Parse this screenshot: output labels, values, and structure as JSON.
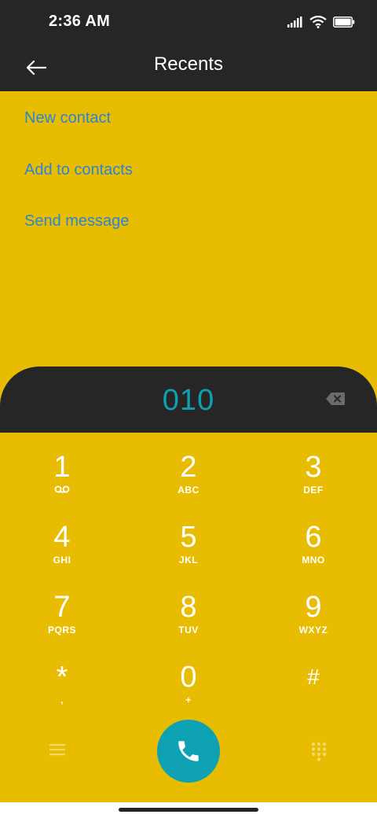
{
  "status": {
    "time": "2:36 AM"
  },
  "app_bar": {
    "title": "Recents"
  },
  "actions": [
    {
      "label": "New contact"
    },
    {
      "label": "Add to contacts"
    },
    {
      "label": "Send message"
    }
  ],
  "dialer": {
    "number": "010",
    "keys": [
      {
        "digit": "1",
        "letters": ""
      },
      {
        "digit": "2",
        "letters": "ABC"
      },
      {
        "digit": "3",
        "letters": "DEF"
      },
      {
        "digit": "4",
        "letters": "GHI"
      },
      {
        "digit": "5",
        "letters": "JKL"
      },
      {
        "digit": "6",
        "letters": "MNO"
      },
      {
        "digit": "7",
        "letters": "PQRS"
      },
      {
        "digit": "8",
        "letters": "TUV"
      },
      {
        "digit": "9",
        "letters": "WXYZ"
      },
      {
        "digit": "*",
        "letters": ","
      },
      {
        "digit": "0",
        "letters": "+"
      },
      {
        "digit": "#",
        "letters": ""
      }
    ]
  },
  "icons": {
    "voicemail": "voicemail-icon",
    "back": "back-arrow-icon",
    "backspace": "backspace-icon",
    "call": "phone-icon",
    "menu": "menu-icon",
    "dialpad": "dialpad-icon"
  },
  "colors": {
    "background": "#E8BC00",
    "dark": "#262626",
    "accent": "#0EA0B3",
    "link": "#2A85D6"
  }
}
